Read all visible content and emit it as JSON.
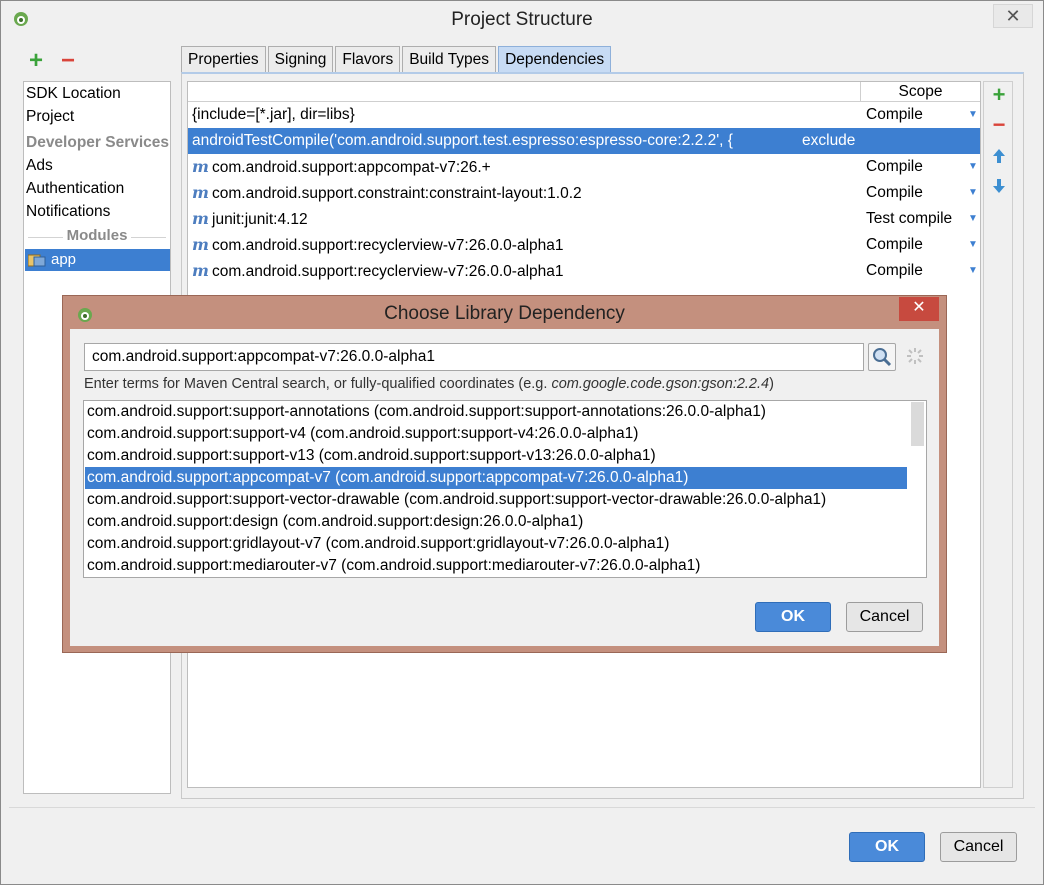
{
  "window": {
    "title": "Project Structure",
    "close_glyph": "✕"
  },
  "left_tools": {
    "add": "+",
    "remove": "−"
  },
  "sidebar": {
    "items": [
      "SDK Location",
      "Project"
    ],
    "section_header": "Developer Services",
    "services": [
      "Ads",
      "Authentication",
      "Notifications"
    ],
    "modules_label": "Modules",
    "module": "app"
  },
  "tabs": [
    {
      "label": "Properties"
    },
    {
      "label": "Signing"
    },
    {
      "label": "Flavors"
    },
    {
      "label": "Build Types"
    },
    {
      "label": "Dependencies",
      "active": true
    }
  ],
  "dependencies": {
    "scope_header": "Scope",
    "rows": [
      {
        "lib": "{include=[*.jar], dir=libs}",
        "scope": "Compile",
        "icon": false
      },
      {
        "lib": "androidTestCompile('com.android.support.test.espresso:espresso-core:2.2.2', {",
        "scope": "",
        "extra": "exclude",
        "selected": true,
        "icon": false
      },
      {
        "lib": "com.android.support:appcompat-v7:26.+",
        "scope": "Compile",
        "icon": true
      },
      {
        "lib": "com.android.support.constraint:constraint-layout:1.0.2",
        "scope": "Compile",
        "icon": true
      },
      {
        "lib": "junit:junit:4.12",
        "scope": "Test compile",
        "icon": true
      },
      {
        "lib": "com.android.support:recyclerview-v7:26.0.0-alpha1",
        "scope": "Compile",
        "icon": true
      },
      {
        "lib": "com.android.support:recyclerview-v7:26.0.0-alpha1",
        "scope": "Compile",
        "icon": true
      }
    ]
  },
  "right_tools": {
    "add": "+",
    "remove": "−",
    "up": "🡅",
    "down": "🡇"
  },
  "buttons": {
    "ok": "OK",
    "cancel": "Cancel"
  },
  "dialog": {
    "title": "Choose Library Dependency",
    "close_glyph": "✕",
    "search_value": "com.android.support:appcompat-v7:26.0.0-alpha1",
    "hint_prefix": "Enter terms for Maven Central search, or fully-qualified coordinates (e.g. ",
    "hint_example": "com.google.code.gson:gson:2.2.4",
    "hint_suffix": ")",
    "results": [
      "com.android.support:support-annotations (com.android.support:support-annotations:26.0.0-alpha1)",
      "com.android.support:support-v4 (com.android.support:support-v4:26.0.0-alpha1)",
      "com.android.support:support-v13 (com.android.support:support-v13:26.0.0-alpha1)",
      "com.android.support:appcompat-v7 (com.android.support:appcompat-v7:26.0.0-alpha1)",
      "com.android.support:support-vector-drawable (com.android.support:support-vector-drawable:26.0.0-alpha1)",
      "com.android.support:design (com.android.support:design:26.0.0-alpha1)",
      "com.android.support:gridlayout-v7 (com.android.support:gridlayout-v7:26.0.0-alpha1)",
      "com.android.support:mediarouter-v7 (com.android.support:mediarouter-v7:26.0.0-alpha1)"
    ],
    "selected_result": 3,
    "ok": "OK",
    "cancel": "Cancel"
  },
  "colors": {
    "selection": "#3d7fd1",
    "accent_green": "#3aa23a",
    "accent_red": "#d9443a",
    "dialog_frame": "#c4907e"
  }
}
